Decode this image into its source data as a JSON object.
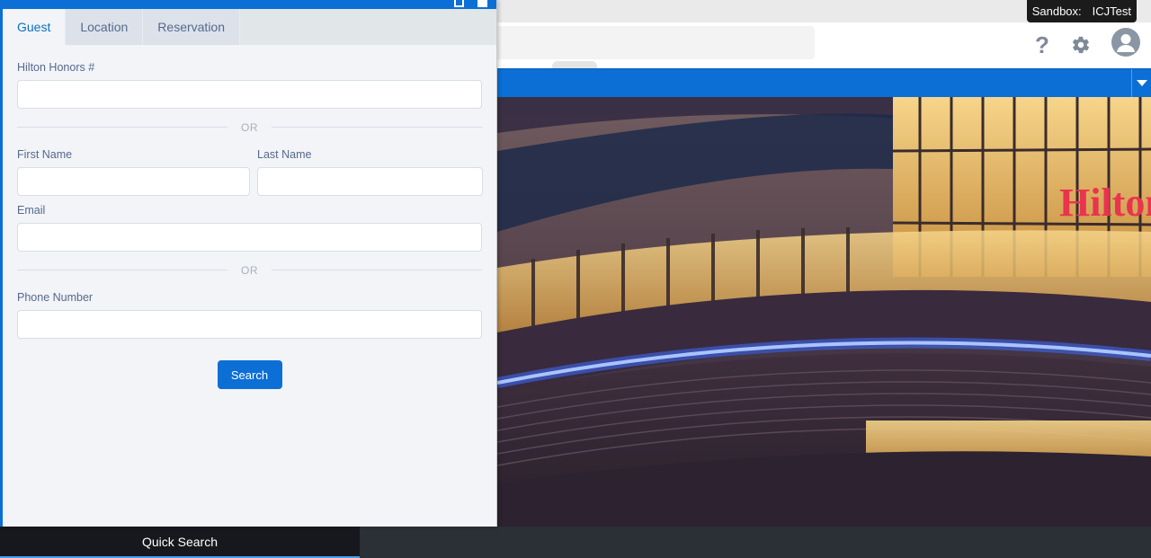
{
  "sandbox": {
    "label": "Sandbox:",
    "name": "ICJTest"
  },
  "header": {
    "help_icon": "question-mark-icon",
    "settings_icon": "gear-icon",
    "avatar_icon": "user-avatar-icon"
  },
  "panel": {
    "tabs": [
      {
        "label": "Guest",
        "active": true
      },
      {
        "label": "Location",
        "active": false
      },
      {
        "label": "Reservation",
        "active": false
      }
    ],
    "form": {
      "honors_label": "Hilton Honors #",
      "honors_value": "",
      "or_1": "OR",
      "first_name_label": "First Name",
      "first_name_value": "",
      "last_name_label": "Last Name",
      "last_name_value": "",
      "email_label": "Email",
      "email_value": "",
      "or_2": "OR",
      "phone_label": "Phone Number",
      "phone_value": "",
      "search_button": "Search"
    }
  },
  "hero": {
    "sign_text": "Hilton"
  },
  "utility_bar": {
    "quick_search_label": "Quick Search"
  },
  "colors": {
    "brand_blue": "#0b6fd6",
    "tab_active_text": "#0a6fc2",
    "sign_red": "#e8344f"
  }
}
